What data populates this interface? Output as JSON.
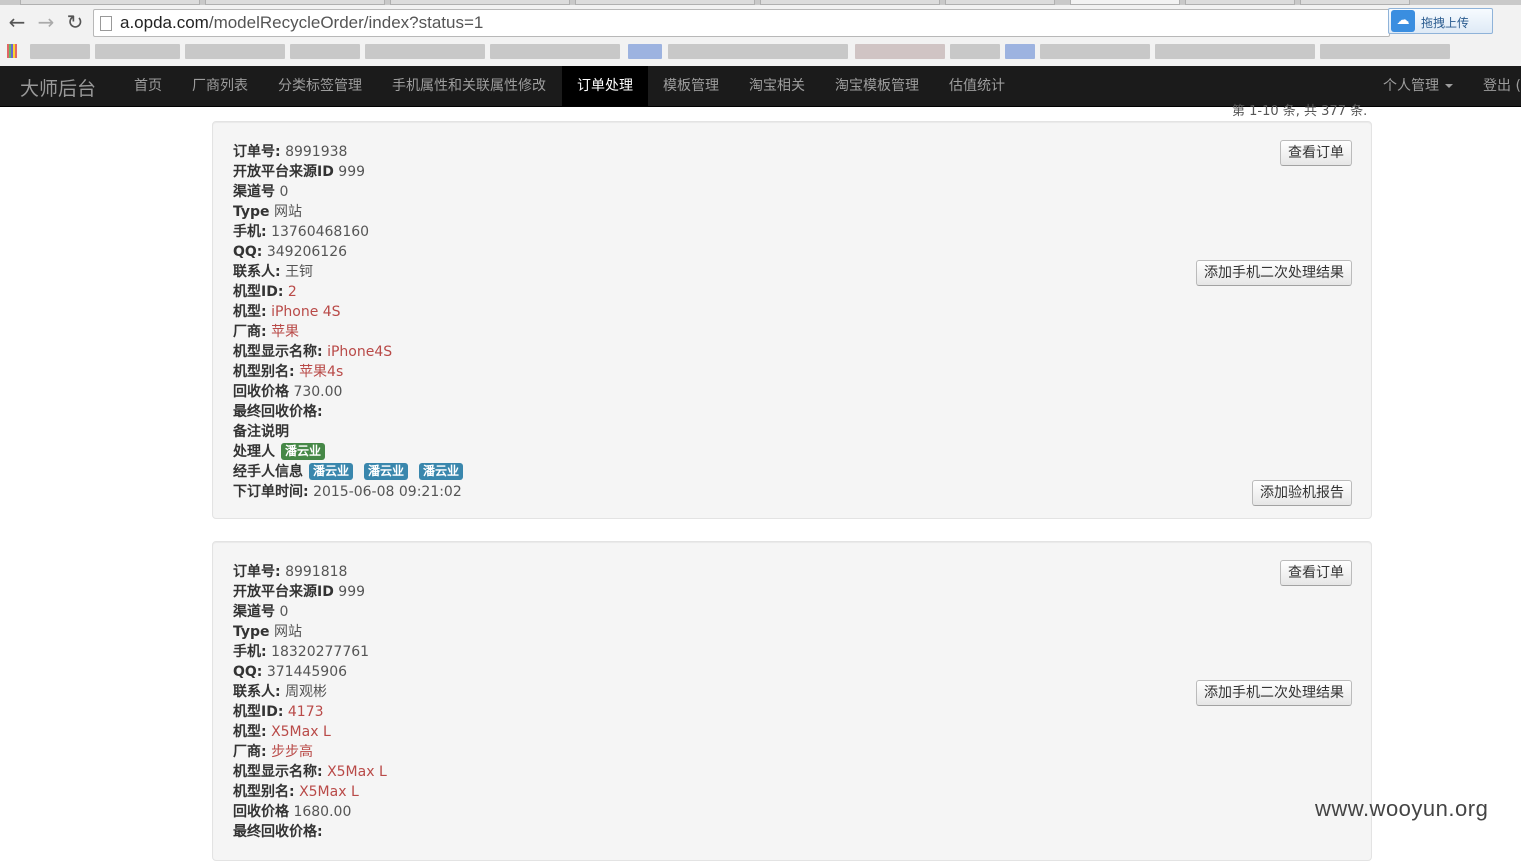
{
  "browser": {
    "url_host": "a.opda.com",
    "url_path": "/modelRecycleOrder/index?status=1",
    "extension_label": "拖拽上传"
  },
  "navbar": {
    "brand": "大师后台",
    "items": [
      "首页",
      "厂商列表",
      "分类标签管理",
      "手机属性和关联属性修改",
      "订单处理",
      "模板管理",
      "淘宝相关",
      "淘宝模板管理",
      "估值统计"
    ],
    "active_index": 4,
    "user_menu": "个人管理",
    "logout": "登出 ("
  },
  "pager_text": "第 1-10 条, 共 377 条.",
  "orders": [
    {
      "order_no_label": "订单号:",
      "order_no": "8991938",
      "source_label": "开放平台来源ID",
      "source": "999",
      "channel_label": "渠道号",
      "channel": "0",
      "type_label": "Type",
      "type": "网站",
      "phone_label": "手机:",
      "phone": "13760468160",
      "qq_label": "QQ:",
      "qq": "349206126",
      "contact_label": "联系人:",
      "contact": "王钶",
      "model_id_label": "机型ID:",
      "model_id": "2",
      "model_label": "机型:",
      "model": "iPhone 4S",
      "vendor_label": "厂商:",
      "vendor": "苹果",
      "display_name_label": "机型显示名称:",
      "display_name": "iPhone4S",
      "alias_label": "机型别名:",
      "alias": "苹果4s",
      "price_label": "回收价格",
      "price": "730.00",
      "final_price_label": "最终回收价格:",
      "remark_label": "备注说明",
      "handler_label": "处理人",
      "handler": "潘云业",
      "agent_label": "经手人信息",
      "agents": [
        "潘云业",
        "潘云业",
        "潘云业"
      ],
      "time_label": "下订单时间:",
      "time": "2015-06-08 09:21:02",
      "btn_view": "查看订单",
      "btn_second": "添加手机二次处理结果",
      "btn_report": "添加验机报告"
    },
    {
      "order_no_label": "订单号:",
      "order_no": "8991818",
      "source_label": "开放平台来源ID",
      "source": "999",
      "channel_label": "渠道号",
      "channel": "0",
      "type_label": "Type",
      "type": "网站",
      "phone_label": "手机:",
      "phone": "18320277761",
      "qq_label": "QQ:",
      "qq": "371445906",
      "contact_label": "联系人:",
      "contact": "周观彬",
      "model_id_label": "机型ID:",
      "model_id": "4173",
      "model_label": "机型:",
      "model": "X5Max L",
      "vendor_label": "厂商:",
      "vendor": "步步高",
      "display_name_label": "机型显示名称:",
      "display_name": "X5Max L",
      "alias_label": "机型别名:",
      "alias": "X5Max L",
      "price_label": "回收价格",
      "price": "1680.00",
      "final_price_label": "最终回收价格:",
      "btn_view": "查看订单",
      "btn_second": "添加手机二次处理结果"
    }
  ],
  "watermark": "www.wooyun.org"
}
